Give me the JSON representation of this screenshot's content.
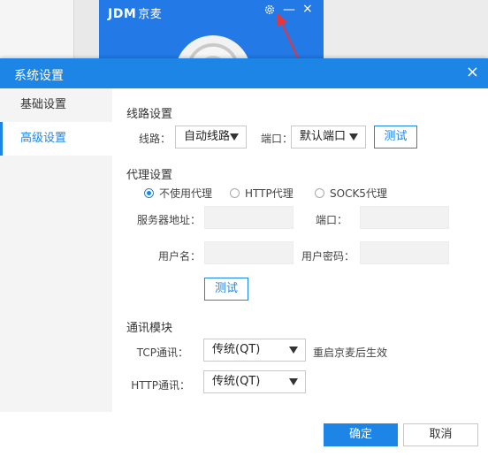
{
  "app": {
    "logo": "JDM",
    "logo_sub": "京麦"
  },
  "dialog": {
    "title": "系统设置",
    "close": "×"
  },
  "sidebar": {
    "items": [
      {
        "label": "基础设置",
        "active": false
      },
      {
        "label": "高级设置",
        "active": true
      }
    ]
  },
  "route": {
    "title": "线路设置",
    "route_label": "线路：",
    "route_value": "自动线路",
    "port_label": "端口：",
    "port_value": "默认端口",
    "test_button": "测试"
  },
  "proxy": {
    "title": "代理设置",
    "options": [
      {
        "label": "不使用代理",
        "checked": true
      },
      {
        "label": "HTTP代理",
        "checked": false
      },
      {
        "label": "SOCK5代理",
        "checked": false
      }
    ],
    "server_label": "服务器地址：",
    "port_label": "端口：",
    "username_label": "用户名：",
    "password_label": "用户密码：",
    "server_value": "",
    "port_value": "",
    "username_value": "",
    "password_value": "",
    "test_button": "测试"
  },
  "comm": {
    "title": "通讯模块",
    "tcp_label": "TCP通讯：",
    "tcp_value": "传统(QT)",
    "tcp_note": "重启京麦后生效",
    "http_label": "HTTP通讯：",
    "http_value": "传统(QT)"
  },
  "footer": {
    "ok_button": "确定",
    "cancel_button": "取消"
  },
  "colors": {
    "accent": "#1d85e5",
    "annotation_arrow": "#e8343a"
  }
}
